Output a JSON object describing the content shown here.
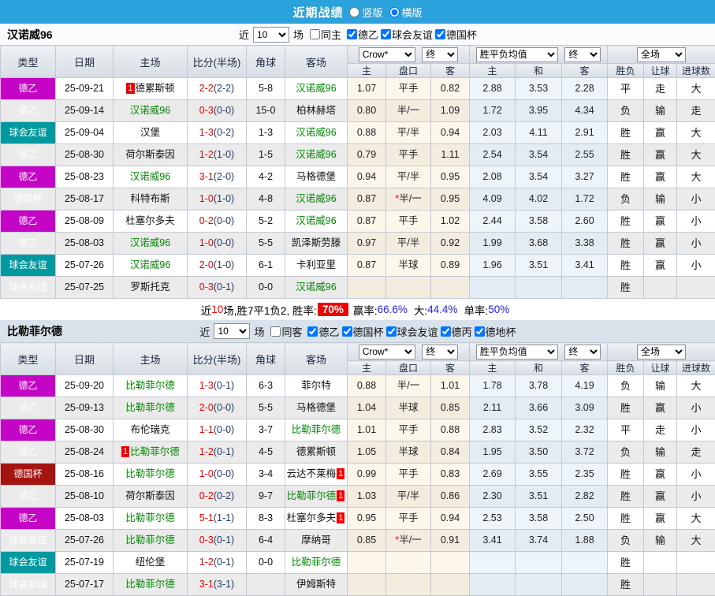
{
  "topbar": {
    "title": "近期战绩",
    "radio_vertical": "竖版",
    "radio_horizontal": "横版"
  },
  "table_header": {
    "type": "类型",
    "date": "日期",
    "home": "主场",
    "score": "比分(半场)",
    "corner": "角球",
    "away": "客场",
    "odds_select": "Crow*",
    "odds_final": "终",
    "odds_cols": [
      "主",
      "盘口",
      "客"
    ],
    "wdl_select": "胜平负均值",
    "wdl_final": "终",
    "wdl_cols": [
      "主",
      "和",
      "客"
    ],
    "full_select": "全场",
    "full_cols": [
      "胜负",
      "让球",
      "进球数"
    ]
  },
  "colors": {
    "topbar_blue": "#2ba2db",
    "league_de2": "#c505c5",
    "league_friendly": "#00999f",
    "league_cup": "#a41411",
    "team_green": "#008800",
    "score_red": "#e60000",
    "win_red": "#dd0000",
    "draw_blue": "#1414dd",
    "lose_green": "#0a860a",
    "badge_red": "#f20000"
  },
  "sections": [
    {
      "team": "汉诺威96",
      "filters": {
        "near": "近",
        "count": "10",
        "games": "场",
        "same_label": "同主",
        "same_checked": false,
        "leagues": [
          {
            "label": "德乙",
            "checked": true
          },
          {
            "label": "球会友谊",
            "checked": true
          },
          {
            "label": "德国杯",
            "checked": true
          }
        ]
      },
      "rows": [
        {
          "league": "德乙",
          "date": "25-09-21",
          "home": {
            "name": "德累斯顿",
            "badge": "1",
            "badge_pos": "before"
          },
          "ft": "2-2",
          "ht": "2-2",
          "corner": "5-8",
          "away": {
            "name": "汉诺威96",
            "green": true
          },
          "odds": [
            "1.07",
            "平手",
            "0.82"
          ],
          "avg": [
            "2.88",
            "3.53",
            "2.28"
          ],
          "results": [
            "平",
            "走",
            "大"
          ]
        },
        {
          "league": "德乙",
          "date": "25-09-14",
          "home": {
            "name": "汉诺威96",
            "green": true
          },
          "ft": "0-3",
          "ht": "0-0",
          "corner": "15-0",
          "away": {
            "name": "柏林赫塔"
          },
          "odds": [
            "0.80",
            "半/一",
            "1.09"
          ],
          "avg": [
            "1.72",
            "3.95",
            "4.34"
          ],
          "results": [
            "负",
            "输",
            "走"
          ]
        },
        {
          "league": "球会友谊",
          "date": "25-09-04",
          "home": {
            "name": "汉堡"
          },
          "ft": "1-3",
          "ht": "0-2",
          "corner": "1-3",
          "away": {
            "name": "汉诺威96",
            "green": true
          },
          "odds": [
            "0.88",
            "平/半",
            "0.94"
          ],
          "avg": [
            "2.03",
            "4.11",
            "2.91"
          ],
          "results": [
            "胜",
            "赢",
            "大"
          ]
        },
        {
          "league": "德乙",
          "date": "25-08-30",
          "home": {
            "name": "荷尔斯泰因"
          },
          "ft": "1-2",
          "ht": "1-0",
          "corner": "1-5",
          "away": {
            "name": "汉诺威96",
            "green": true
          },
          "odds": [
            "0.79",
            "平手",
            "1.11"
          ],
          "avg": [
            "2.54",
            "3.54",
            "2.55"
          ],
          "results": [
            "胜",
            "赢",
            "大"
          ]
        },
        {
          "league": "德乙",
          "date": "25-08-23",
          "home": {
            "name": "汉诺威96",
            "green": true
          },
          "ft": "3-1",
          "ht": "2-0",
          "corner": "4-2",
          "away": {
            "name": "马格德堡"
          },
          "odds": [
            "0.94",
            "平/半",
            "0.95"
          ],
          "avg": [
            "2.08",
            "3.54",
            "3.27"
          ],
          "results": [
            "胜",
            "赢",
            "大"
          ]
        },
        {
          "league": "德国杯",
          "date": "25-08-17",
          "home": {
            "name": "科特布斯"
          },
          "ft": "1-0",
          "ht": "1-0",
          "corner": "4-8",
          "away": {
            "name": "汉诺威96",
            "green": true
          },
          "odds": [
            "0.87",
            "*半/一",
            "0.95"
          ],
          "avg": [
            "4.09",
            "4.02",
            "1.72"
          ],
          "results": [
            "负",
            "输",
            "小"
          ]
        },
        {
          "league": "德乙",
          "date": "25-08-09",
          "home": {
            "name": "杜塞尔多夫"
          },
          "ft": "0-2",
          "ht": "0-0",
          "corner": "5-2",
          "away": {
            "name": "汉诺威96",
            "green": true
          },
          "odds": [
            "0.87",
            "平手",
            "1.02"
          ],
          "avg": [
            "2.44",
            "3.58",
            "2.60"
          ],
          "results": [
            "胜",
            "赢",
            "小"
          ]
        },
        {
          "league": "德乙",
          "date": "25-08-03",
          "home": {
            "name": "汉诺威96",
            "green": true
          },
          "ft": "1-0",
          "ht": "0-0",
          "corner": "5-5",
          "away": {
            "name": "凯泽斯劳滕"
          },
          "odds": [
            "0.97",
            "平/半",
            "0.92"
          ],
          "avg": [
            "1.99",
            "3.68",
            "3.38"
          ],
          "results": [
            "胜",
            "赢",
            "小"
          ]
        },
        {
          "league": "球会友谊",
          "date": "25-07-26",
          "home": {
            "name": "汉诺威96",
            "green": true
          },
          "ft": "2-0",
          "ht": "1-0",
          "corner": "6-1",
          "away": {
            "name": "卡利亚里"
          },
          "odds": [
            "0.87",
            "半球",
            "0.89"
          ],
          "avg": [
            "1.96",
            "3.51",
            "3.41"
          ],
          "results": [
            "胜",
            "赢",
            "小"
          ]
        },
        {
          "league": "球会友谊",
          "date": "25-07-25",
          "home": {
            "name": "罗斯托克"
          },
          "ft": "0-3",
          "ht": "0-1",
          "corner": "0-0",
          "away": {
            "name": "汉诺威96",
            "green": true
          },
          "odds": [
            "",
            "",
            ""
          ],
          "avg": [
            "",
            "",
            ""
          ],
          "results": [
            "胜",
            "",
            ""
          ]
        }
      ],
      "summary": {
        "pre": "近",
        "count": "10",
        "mid": "场,胜7平1负2, 胜率:",
        "rate": "70%",
        "stats": [
          {
            "label": "赢率:",
            "value": "66.6%"
          },
          {
            "label": "大:",
            "value": "44.4%"
          },
          {
            "label": "单率:",
            "value": "50%"
          }
        ]
      }
    },
    {
      "team": "比勒菲尔德",
      "filters": {
        "near": "近",
        "count": "10",
        "games": "场",
        "same_label": "同客",
        "same_checked": false,
        "leagues": [
          {
            "label": "德乙",
            "checked": true
          },
          {
            "label": "德国杯",
            "checked": true
          },
          {
            "label": "球会友谊",
            "checked": true
          },
          {
            "label": "德丙",
            "checked": true
          },
          {
            "label": "德地杯",
            "checked": true
          }
        ]
      },
      "rows": [
        {
          "league": "德乙",
          "date": "25-09-20",
          "home": {
            "name": "比勒菲尔德",
            "green": true
          },
          "ft": "1-3",
          "ht": "0-1",
          "corner": "6-3",
          "away": {
            "name": "菲尔特"
          },
          "odds": [
            "0.88",
            "半/一",
            "1.01"
          ],
          "avg": [
            "1.78",
            "3.78",
            "4.19"
          ],
          "results": [
            "负",
            "输",
            "大"
          ]
        },
        {
          "league": "德乙",
          "date": "25-09-13",
          "home": {
            "name": "比勒菲尔德",
            "green": true
          },
          "ft": "2-0",
          "ht": "0-0",
          "corner": "5-5",
          "away": {
            "name": "马格德堡"
          },
          "odds": [
            "1.04",
            "半球",
            "0.85"
          ],
          "avg": [
            "2.11",
            "3.66",
            "3.09"
          ],
          "results": [
            "胜",
            "赢",
            "小"
          ]
        },
        {
          "league": "德乙",
          "date": "25-08-30",
          "home": {
            "name": "布伦瑞克"
          },
          "ft": "1-1",
          "ht": "0-0",
          "corner": "3-7",
          "away": {
            "name": "比勒菲尔德",
            "green": true
          },
          "odds": [
            "1.01",
            "平手",
            "0.88"
          ],
          "avg": [
            "2.83",
            "3.52",
            "2.32"
          ],
          "results": [
            "平",
            "走",
            "小"
          ]
        },
        {
          "league": "德乙",
          "date": "25-08-24",
          "home": {
            "name": "比勒菲尔德",
            "green": true,
            "badge": "1",
            "badge_pos": "before"
          },
          "ft": "1-2",
          "ht": "0-1",
          "corner": "4-5",
          "away": {
            "name": "德累斯顿"
          },
          "odds": [
            "1.05",
            "半球",
            "0.84"
          ],
          "avg": [
            "1.95",
            "3.50",
            "3.72"
          ],
          "results": [
            "负",
            "输",
            "走"
          ]
        },
        {
          "league": "德国杯",
          "date": "25-08-16",
          "home": {
            "name": "比勒菲尔德",
            "green": true
          },
          "ft": "1-0",
          "ht": "0-0",
          "corner": "3-4",
          "away": {
            "name": "云达不莱梅",
            "badge": "1",
            "badge_pos": "after"
          },
          "odds": [
            "0.99",
            "平手",
            "0.83"
          ],
          "avg": [
            "2.69",
            "3.55",
            "2.35"
          ],
          "results": [
            "胜",
            "赢",
            "小"
          ]
        },
        {
          "league": "德乙",
          "date": "25-08-10",
          "home": {
            "name": "荷尔斯泰因"
          },
          "ft": "0-2",
          "ht": "0-2",
          "corner": "9-7",
          "away": {
            "name": "比勒菲尔德",
            "green": true,
            "badge": "1",
            "badge_pos": "after"
          },
          "odds": [
            "1.03",
            "平/半",
            "0.86"
          ],
          "avg": [
            "2.30",
            "3.51",
            "2.82"
          ],
          "results": [
            "胜",
            "赢",
            "小"
          ]
        },
        {
          "league": "德乙",
          "date": "25-08-03",
          "home": {
            "name": "比勒菲尔德",
            "green": true
          },
          "ft": "5-1",
          "ht": "1-1",
          "corner": "8-3",
          "away": {
            "name": "杜塞尔多夫",
            "badge": "1",
            "badge_pos": "after"
          },
          "odds": [
            "0.95",
            "平手",
            "0.94"
          ],
          "avg": [
            "2.53",
            "3.58",
            "2.50"
          ],
          "results": [
            "胜",
            "赢",
            "大"
          ]
        },
        {
          "league": "球会友谊",
          "date": "25-07-26",
          "home": {
            "name": "比勒菲尔德",
            "green": true
          },
          "ft": "0-3",
          "ht": "0-1",
          "corner": "6-4",
          "away": {
            "name": "摩纳哥"
          },
          "odds": [
            "0.85",
            "*半/一",
            "0.91"
          ],
          "avg": [
            "3.41",
            "3.74",
            "1.88"
          ],
          "results": [
            "负",
            "输",
            "大"
          ]
        },
        {
          "league": "球会友谊",
          "date": "25-07-19",
          "home": {
            "name": "纽伦堡"
          },
          "ft": "1-2",
          "ht": "0-1",
          "corner": "0-0",
          "away": {
            "name": "比勒菲尔德",
            "green": true
          },
          "odds": [
            "",
            "",
            ""
          ],
          "avg": [
            "",
            "",
            ""
          ],
          "results": [
            "胜",
            "",
            ""
          ]
        },
        {
          "league": "球会友谊",
          "date": "25-07-17",
          "home": {
            "name": "比勒菲尔德",
            "green": true
          },
          "ft": "3-1",
          "ht": "3-1",
          "corner": "",
          "away": {
            "name": "伊姆斯特"
          },
          "odds": [
            "",
            "",
            ""
          ],
          "avg": [
            "",
            "",
            ""
          ],
          "results": [
            "胜",
            "",
            ""
          ]
        }
      ]
    }
  ]
}
